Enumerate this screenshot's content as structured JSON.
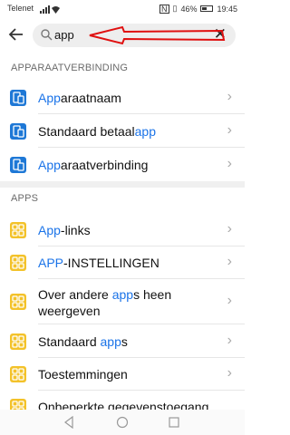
{
  "status": {
    "carrier": "Telenet",
    "battery": "46%",
    "time": "19:45"
  },
  "search": {
    "query": "app"
  },
  "sections": [
    {
      "title": "APPARAATVERBINDING",
      "items": [
        {
          "pre": "",
          "hl": "App",
          "post": "araatnaam"
        },
        {
          "pre": "Standaard betaal",
          "hl": "app",
          "post": ""
        },
        {
          "pre": "",
          "hl": "App",
          "post": "araatverbinding"
        }
      ]
    },
    {
      "title": "APPS",
      "items": [
        {
          "pre": "",
          "hl": "App",
          "post": "-links"
        },
        {
          "pre": "",
          "hl": "APP",
          "post": "-INSTELLINGEN"
        },
        {
          "pre": "Over andere ",
          "hl": "app",
          "post": "s heen weergeven"
        },
        {
          "pre": "Standaard ",
          "hl": "app",
          "post": "s"
        },
        {
          "pre": "Toestemmingen",
          "hl": "",
          "post": ""
        },
        {
          "pre": "Onbeperkte gegevenstoegang",
          "hl": "",
          "post": ""
        }
      ]
    }
  ],
  "colors": {
    "accent": "#1a73e8",
    "icon_blue": "#1e78d6",
    "icon_yellow": "#f3c22a",
    "annotation": "#e01010"
  }
}
